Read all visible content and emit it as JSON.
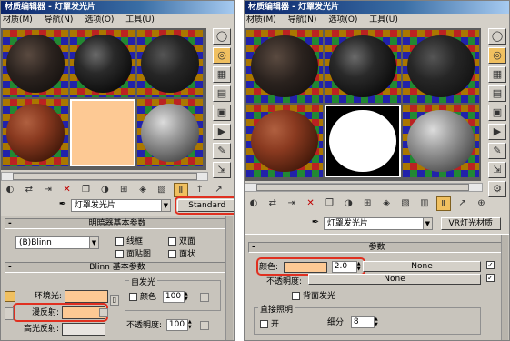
{
  "left": {
    "title": "材质编辑器 - 灯罩发光片",
    "menu": [
      "材质(M)",
      "导航(N)",
      "选项(O)",
      "工具(U)"
    ],
    "slots": [
      "dark-bark",
      "dark",
      "dark-noise",
      "wood",
      "peach",
      "grey"
    ],
    "material_name": "灯罩发光片",
    "material_type_button": "Standard",
    "shader_rollout": "明暗器基本参数",
    "shader_type": "(B)Blinn",
    "shader_options": [
      "线框",
      "双面",
      "面贴图",
      "面状"
    ],
    "blinn_rollout": "Blinn 基本参数",
    "self_illum_group": "自发光",
    "color_label": "颜色",
    "color_value": "100",
    "ambient_label": "环境光:",
    "diffuse_label": "漫反射:",
    "specular_label": "高光反射:",
    "opacity_label": "不透明度:",
    "opacity_value": "100",
    "lock_icon": "lock-icon"
  },
  "right": {
    "title": "材质编辑器 - 灯罩发光片",
    "menu": [
      "材质(M)",
      "导航(N)",
      "选项(O)",
      "工具(U)"
    ],
    "slots": [
      "dark-bark",
      "dark",
      "dark-noise",
      "wood",
      "white",
      "grey"
    ],
    "material_name": "灯罩发光片",
    "material_type_button": "VR灯光材质",
    "params_rollout": "参数",
    "color_label": "颜色:",
    "color_multiplier": "2.0",
    "color_map": "None",
    "opacity_label": "不透明度:",
    "opacity_map": "None",
    "backface_label": "背面发光",
    "direct_lighting_group": "直接照明",
    "on_label": "开",
    "subdivs_label": "细分:",
    "subdivs_value": "8"
  },
  "colors": {
    "diffuse": "#fdc994",
    "highlight": "#e03020",
    "title_bar": "#0a246a"
  }
}
